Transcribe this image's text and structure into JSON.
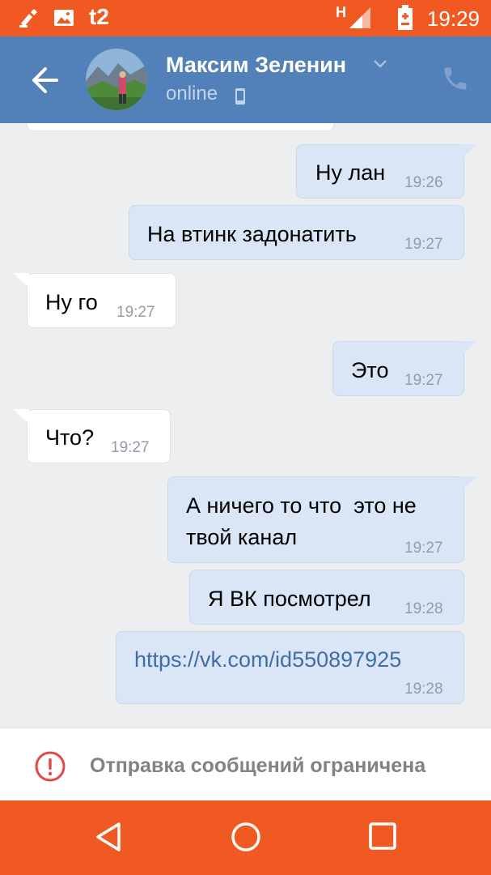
{
  "status_bar": {
    "carrier": "t2",
    "network": "H",
    "time": "19:29",
    "icons": [
      "cleaner-icon",
      "image-icon",
      "signal-icon",
      "battery-charging-icon"
    ]
  },
  "header": {
    "contact_name": "Максим Зеленин",
    "status": "online",
    "icons": [
      "back-arrow-icon",
      "chevron-down-icon",
      "mobile-device-icon",
      "phone-icon"
    ]
  },
  "messages": [
    {
      "direction": "out",
      "text": "Ну лан",
      "time": "19:26"
    },
    {
      "direction": "out",
      "text": "На втинк задонатить",
      "time": "19:27"
    },
    {
      "direction": "in",
      "text": "Ну го",
      "time": "19:27"
    },
    {
      "direction": "out",
      "text": "Это",
      "time": "19:27"
    },
    {
      "direction": "in",
      "text": "Что?",
      "time": "19:27"
    },
    {
      "direction": "out",
      "line1": "А ничего то что  это не",
      "line2": "твой канал",
      "time": "19:27"
    },
    {
      "direction": "out",
      "text": "Я ВК посмотрел",
      "time": "19:28"
    },
    {
      "direction": "out",
      "text": "https://vk.com/id550897925",
      "time": "19:28",
      "is_link": true
    }
  ],
  "footer": {
    "notice": "Отправка сообщений ограничена",
    "icon": "exclamation-circle-icon"
  },
  "nav_bar": {
    "buttons": [
      "back-triangle-icon",
      "home-circle-icon",
      "recents-square-icon"
    ]
  },
  "colors": {
    "status_bar": "#f05a22",
    "header": "#5181b8",
    "outgoing_bubble": "#dae6f5",
    "incoming_bubble": "#ffffff",
    "link": "#3f6ea8",
    "warning": "#e64646"
  }
}
